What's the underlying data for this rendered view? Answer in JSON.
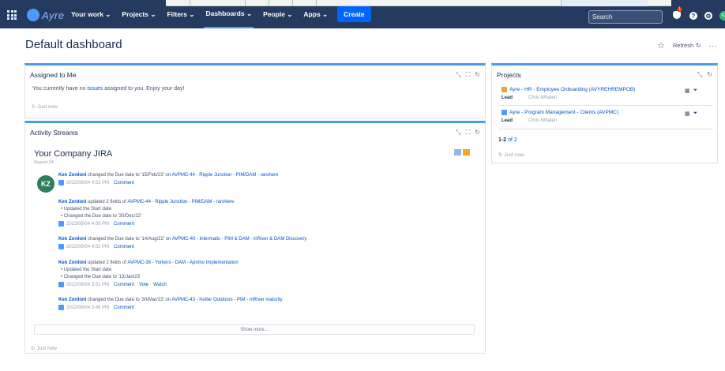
{
  "topbar": {
    "logo": "Ayre",
    "nav": [
      "Your work",
      "Projects",
      "Filters",
      "Dashboards",
      "People",
      "Apps"
    ],
    "create": "Create",
    "search_placeholder": "Search",
    "notification_count": "1",
    "avatar_initials": "KZ"
  },
  "page": {
    "title": "Default dashboard",
    "refresh": "Refresh"
  },
  "assigned": {
    "title": "Assigned to Me",
    "msg_before": "You currently have no",
    "msg_link": "issues",
    "msg_after": "assigned to you. Enjoy your day!",
    "updated": "Just now"
  },
  "activity": {
    "title": "Activity Streams",
    "stream_title": "Your Company JIRA",
    "stream_sub": "August 04",
    "avatar": "KZ",
    "entries": [
      {
        "who": "Ken Zordoni",
        "text": "changed the Due date to '15/Feb/23' on",
        "link": "AVPMC-44 - Ripple Junction - PIM/DAM - rarohere",
        "details": [],
        "time": "2022/08/04 4:53 PM",
        "actions": [
          "Comment"
        ]
      },
      {
        "who": "Ken Zordoni",
        "text": "updated 2 fields of",
        "link": "AVPMC-44 - Ripple Junction - PIM/DAM - rarohere",
        "details": [
          "Updated the Start date",
          "Changed the Due date to '30/Dec/22'"
        ],
        "time": "2022/08/04 4:09 PM",
        "actions": [
          "Comment"
        ]
      },
      {
        "who": "Ken Zordoni",
        "text": "changed the Due date to '14/Aug/22' on",
        "link": "AVPMC-40 - Intermatic - PIM & DAM - inRiver & DAM Discovery",
        "details": [],
        "time": "2022/08/04 4:52 PM",
        "actions": [
          "Comment"
        ]
      },
      {
        "who": "Ken Zordoni",
        "text": "updated 2 fields of",
        "link": "AVPMC-38 - Yorkers - DAM - Aprimo Implementation",
        "details": [
          "Updated the Start date",
          "Changed the Due date to '13/Jan/23'"
        ],
        "time": "2022/08/04 3:51 PM",
        "actions": [
          "Comment",
          "Vote",
          "Watch"
        ]
      },
      {
        "who": "Ken Zordoni",
        "text": "changed the Due date to '30/Mar/23' on",
        "link": "AVPMC-43 - Ketter Outdoors - PIM - inRiver maturity",
        "details": [],
        "time": "2022/08/04 3:46 PM",
        "actions": [
          "Comment"
        ]
      }
    ],
    "show_more": "Show more...",
    "updated": "Just now"
  },
  "projects": {
    "title": "Projects",
    "items": [
      {
        "name": "Ayre - HR - Employee Onboarding (AVYREHREMPOB)",
        "lead_label": "Lead",
        "lead": "Chris Whalen",
        "icon_color": "#e8a33b"
      },
      {
        "name": "Ayre - Program Management - Clients (AVPMC)",
        "lead_label": "Lead",
        "lead": "Chris Whalen",
        "icon_color": "#4c9aff"
      }
    ],
    "pager": "1-2",
    "pager_of": "of 2",
    "updated": "Just now"
  }
}
